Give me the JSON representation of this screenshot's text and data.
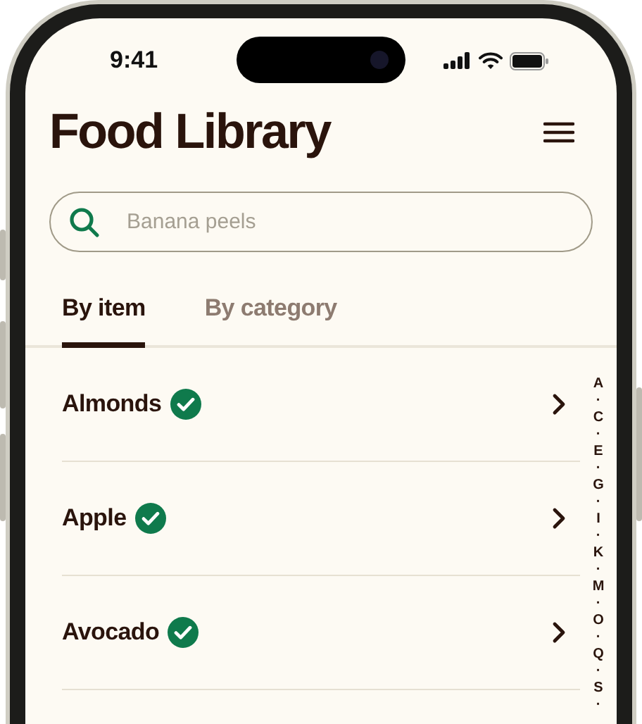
{
  "status_bar": {
    "time": "9:41"
  },
  "title": "Food Library",
  "search": {
    "placeholder": "Banana peels"
  },
  "tabs": [
    {
      "label": "By item",
      "selected": true
    },
    {
      "label": "By category",
      "selected": false
    }
  ],
  "items": [
    {
      "name": "Almonds",
      "verified": true
    },
    {
      "name": "Apple",
      "verified": true
    },
    {
      "name": "Avocado",
      "verified": true
    }
  ],
  "index_letters": [
    "A",
    "·",
    "C",
    "·",
    "E",
    "·",
    "G",
    "·",
    "I",
    "·",
    "K",
    "·",
    "M",
    "·",
    "O",
    "·",
    "Q",
    "·",
    "S",
    "·"
  ]
}
